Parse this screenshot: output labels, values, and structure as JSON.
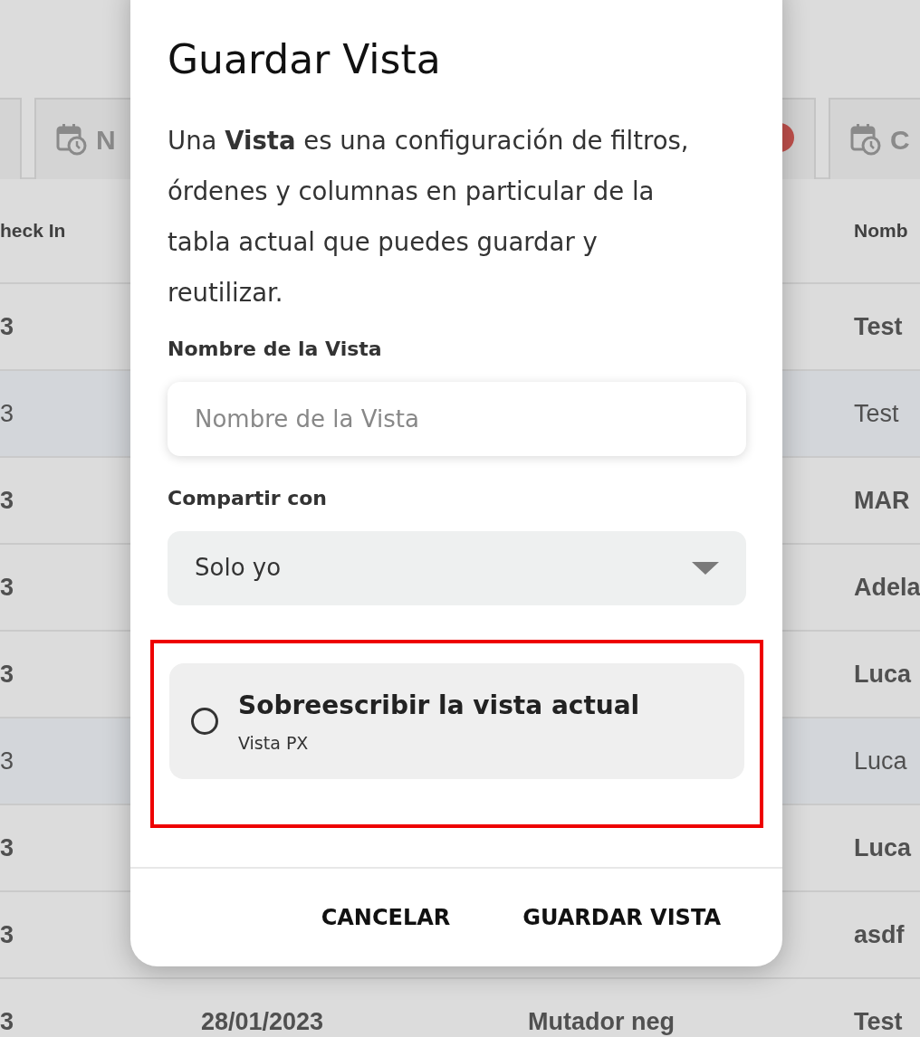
{
  "background": {
    "tabs": [
      {
        "kind": "blank"
      },
      {
        "kind": "calendar",
        "label": "N"
      },
      {
        "kind": "badge"
      },
      {
        "kind": "calendar",
        "label": "C"
      }
    ],
    "table": {
      "header": {
        "column_1": "heck In",
        "column_4": "Nomb"
      },
      "rows": [
        {
          "column_1": "3",
          "column_4": "Test",
          "selected": false
        },
        {
          "column_1": "3",
          "column_4": "Test",
          "selected": true
        },
        {
          "column_1": "3",
          "column_4": "MAR",
          "selected": false
        },
        {
          "column_1": "3",
          "column_4": "Adela",
          "selected": false
        },
        {
          "column_1": "3",
          "column_4": "Luca",
          "selected": false
        },
        {
          "column_1": "3",
          "column_4": "Luca",
          "selected": true
        },
        {
          "column_1": "3",
          "column_4": "Luca",
          "selected": false
        },
        {
          "column_1": "3",
          "column_4": "asdf",
          "selected": false
        },
        {
          "column_1": "3",
          "column_2": "28/01/2023",
          "column_3": "Mutador neg",
          "column_4": "Test",
          "selected": false
        }
      ]
    }
  },
  "dialog": {
    "title": "Guardar Vista",
    "description": "Una **Vista** es una configuración de filtros, órdenes y columnas en particular de la tabla actual que puedes guardar y reutilizar.",
    "name_label": "Nombre de la Vista",
    "name_field": {
      "placeholder": "Nombre de la Vista"
    },
    "share_label": "Compartir con",
    "share_select": {
      "value": "Solo yo"
    },
    "overwrite_option": {
      "title": "Sobreescribir la vista actual",
      "subtitle": "Vista PX",
      "checked": false,
      "highlighted": true
    },
    "buttons": [
      "CANCELAR",
      "GUARDAR VISTA"
    ]
  }
}
